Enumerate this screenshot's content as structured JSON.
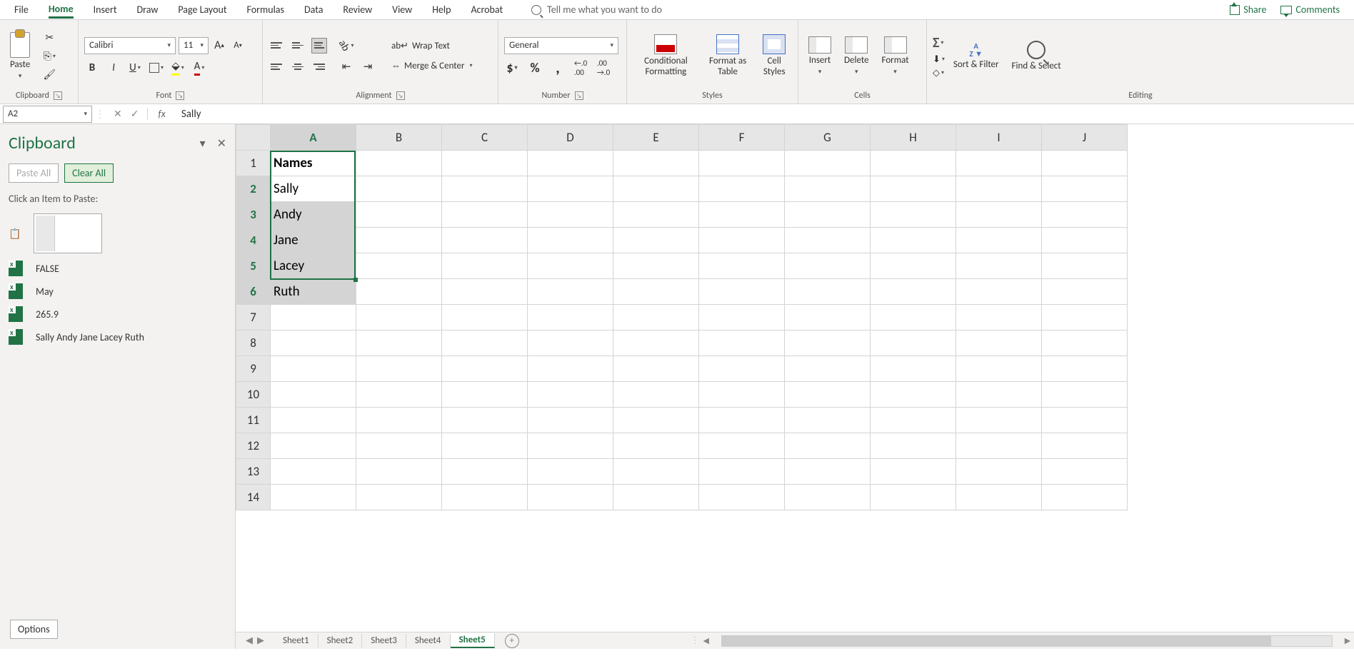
{
  "menu": {
    "tabs": [
      "File",
      "Home",
      "Insert",
      "Draw",
      "Page Layout",
      "Formulas",
      "Data",
      "Review",
      "View",
      "Help",
      "Acrobat"
    ],
    "active": "Home",
    "tell_me": "Tell me what you want to do",
    "share": "Share",
    "comments": "Comments"
  },
  "ribbon": {
    "clipboard": {
      "paste": "Paste",
      "label": "Clipboard"
    },
    "font": {
      "name": "Calibri",
      "size": "11",
      "label": "Font",
      "bold": "B",
      "italic": "I",
      "underline": "U"
    },
    "alignment": {
      "label": "Alignment",
      "wrap": "Wrap Text",
      "merge": "Merge & Center"
    },
    "number": {
      "label": "Number",
      "format": "General",
      "currency": "$",
      "percent": "%",
      "comma": ",",
      "dec_inc": ".00",
      "dec_dec": ".00"
    },
    "styles": {
      "label": "Styles",
      "cond": "Conditional Formatting",
      "table": "Format as Table",
      "cell": "Cell Styles"
    },
    "cells": {
      "label": "Cells",
      "insert": "Insert",
      "delete": "Delete",
      "format": "Format"
    },
    "editing": {
      "label": "Editing",
      "sort": "Sort & Filter",
      "find": "Find & Select"
    }
  },
  "namebox": "A2",
  "formula": "Sally",
  "clipboard_pane": {
    "title": "Clipboard",
    "paste_all": "Paste All",
    "clear_all": "Clear All",
    "hint": "Click an Item to Paste:",
    "options": "Options",
    "items": [
      "FALSE",
      "May",
      "265.9",
      "Sally Andy Jane Lacey Ruth"
    ]
  },
  "sheet": {
    "cols": [
      "A",
      "B",
      "C",
      "D",
      "E",
      "F",
      "G",
      "H",
      "I",
      "J"
    ],
    "rows": [
      "1",
      "2",
      "3",
      "4",
      "5",
      "6",
      "7",
      "8",
      "9",
      "10",
      "11",
      "12",
      "13",
      "14"
    ],
    "data": {
      "A1": "Names",
      "A2": "Sally",
      "A3": "Andy",
      "A4": "Jane",
      "A5": "Lacey",
      "A6": "Ruth"
    },
    "selection": {
      "start": "A2",
      "end": "A6",
      "active": "A2"
    }
  },
  "tabs": {
    "list": [
      "Sheet1",
      "Sheet2",
      "Sheet3",
      "Sheet4",
      "Sheet5"
    ],
    "active": "Sheet5"
  }
}
